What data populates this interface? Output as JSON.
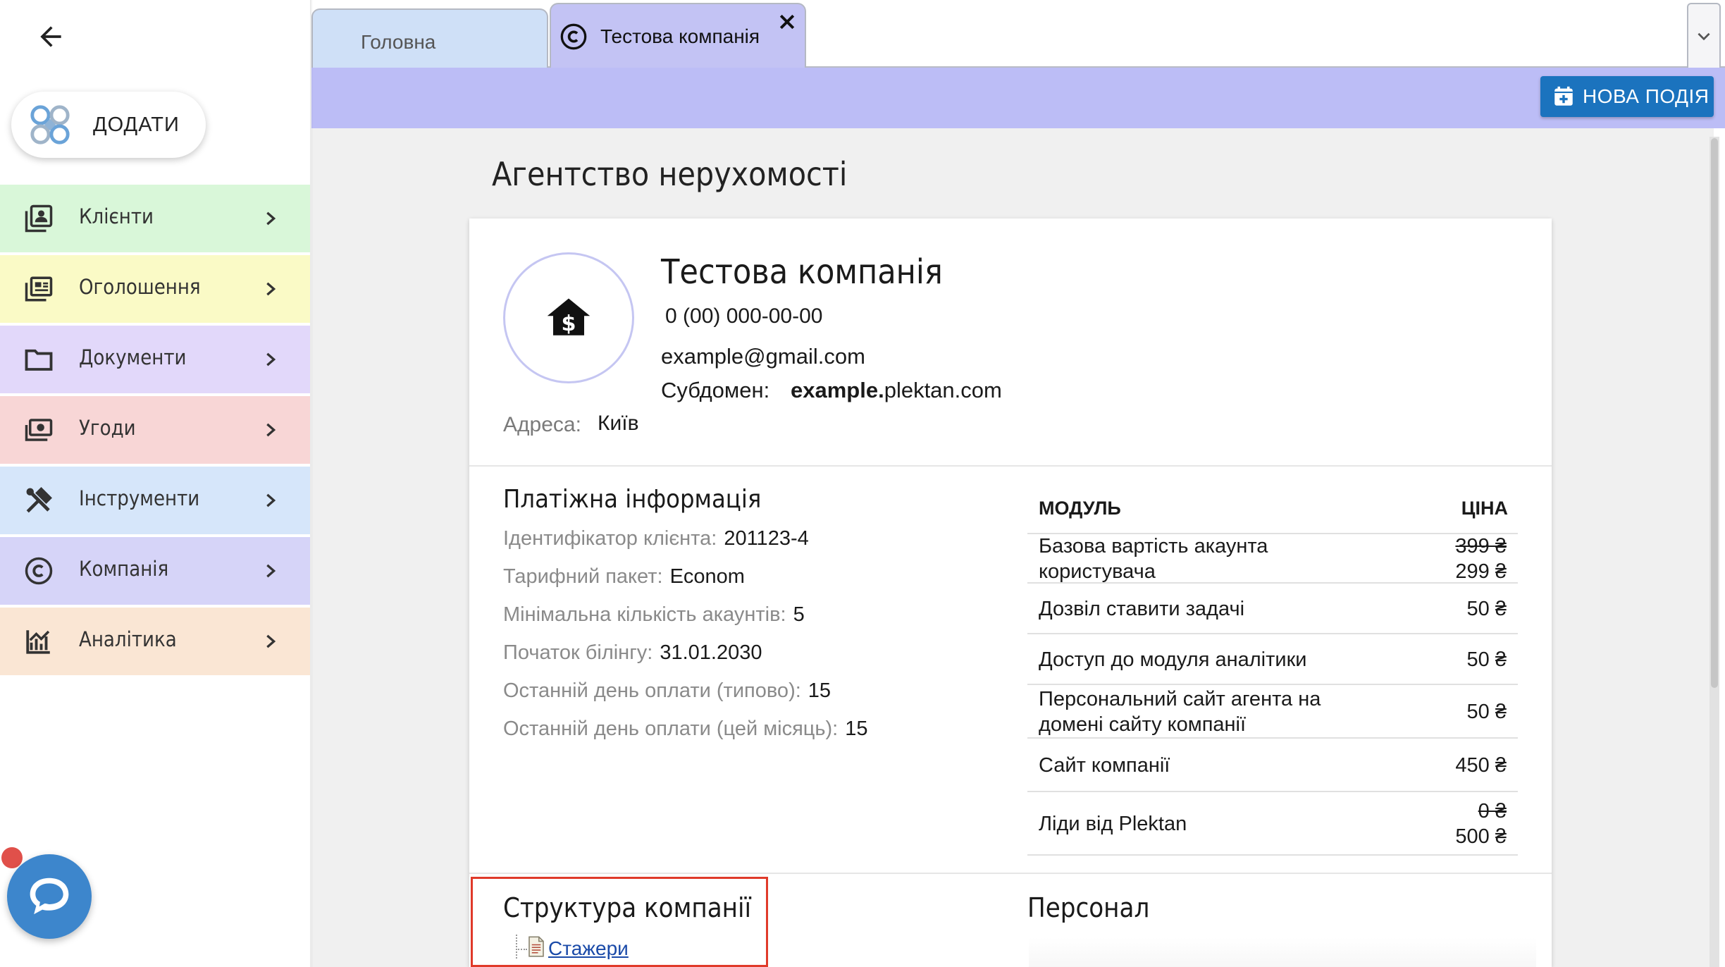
{
  "sidebar": {
    "add_button_label": "ДОДАТИ",
    "menu": [
      {
        "label": "Клієнти",
        "icon": "contacts-icon",
        "bg": "#d9f7d9"
      },
      {
        "label": "Оголошення",
        "icon": "listing-icon",
        "bg": "#fafac6"
      },
      {
        "label": "Документи",
        "icon": "folder-icon",
        "bg": "#e2d8fa"
      },
      {
        "label": "Угоди",
        "icon": "money-icon",
        "bg": "#f8d6d6"
      },
      {
        "label": "Інструменти",
        "icon": "tools-icon",
        "bg": "#d6e6fa"
      },
      {
        "label": "Компанія",
        "icon": "copyright-icon",
        "bg": "#d6d4f8"
      },
      {
        "label": "Аналітика",
        "icon": "analytics-icon",
        "bg": "#fae6d4"
      }
    ]
  },
  "tabs": {
    "home_label": "Головна",
    "company_label": "Тестова компанія"
  },
  "toolbar": {
    "new_event_label": "НОВА ПОДІЯ"
  },
  "page": {
    "title": "Агентство нерухомості"
  },
  "company": {
    "name": "Тестова компанія",
    "phone": "0 (00) 000-00-00",
    "email": "example@gmail.com",
    "subdomain_label": "Субдомен:",
    "subdomain_bold": "example.",
    "subdomain_rest": "plektan.com",
    "address_label": "Адреса:",
    "address_value": "Київ"
  },
  "billing": {
    "title": "Платіжна інформація",
    "rows": [
      {
        "label": "Ідентифікатор клієнта:",
        "value": "201123-4"
      },
      {
        "label": "Тарифний пакет:",
        "value": "Econom"
      },
      {
        "label": "Мінімальна кількість акаунтів:",
        "value": "5"
      },
      {
        "label": "Початок білінгу:",
        "value": "31.01.2030"
      },
      {
        "label": "Останній день оплати (типово):",
        "value": "15"
      },
      {
        "label": "Останній день оплати (цей місяць):",
        "value": "15"
      }
    ]
  },
  "modules": {
    "header_name": "МОДУЛЬ",
    "header_price": "ЦІНА",
    "rows": [
      {
        "name_lines": [
          "Базова вартість акаунта",
          "користувача"
        ],
        "old_price": "399 ₴",
        "price": "299 ₴"
      },
      {
        "name_lines": [
          "Дозвіл ставити задачі"
        ],
        "price": "50 ₴"
      },
      {
        "name_lines": [
          "Доступ до модуля аналітики"
        ],
        "price": "50 ₴"
      },
      {
        "name_lines": [
          "Персональний сайт агента на",
          "домені сайту компанії"
        ],
        "price": "50 ₴"
      },
      {
        "name_lines": [
          "Сайт компанії"
        ],
        "price": "450 ₴"
      },
      {
        "name_lines": [
          "Ліди від Plektan"
        ],
        "old_price": "0 ₴",
        "price": "500 ₴"
      }
    ]
  },
  "structure": {
    "title": "Структура компанії",
    "items": [
      "Стажери"
    ]
  },
  "staff": {
    "title": "Персонал"
  },
  "colors": {
    "accent": "#1b73be",
    "toolbar": "#bcbdf6",
    "highlight": "#e03a2a",
    "chat": "#3d86cc"
  }
}
